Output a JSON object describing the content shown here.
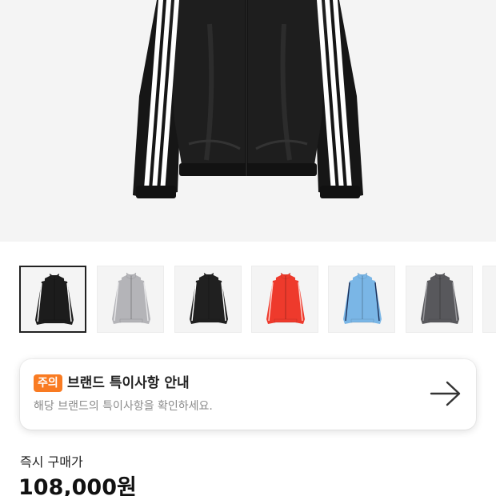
{
  "product": {
    "hero_image": "black track jacket with three white stripes, main photo",
    "thumbnails": [
      {
        "name": "black",
        "body": "#1c1c1c",
        "stripe": "#ffffff",
        "bg": "#f4f4f4",
        "selected": true
      },
      {
        "name": "light-gray",
        "body": "#b4b4b8",
        "stripe": "#e6e6e8",
        "bg": "#f4f4f4",
        "selected": false
      },
      {
        "name": "black-2",
        "body": "#202020",
        "stripe": "#ffffff",
        "bg": "#f4f4f4",
        "selected": false
      },
      {
        "name": "red",
        "body": "#ee3a2c",
        "stripe": "#ffd2cc",
        "bg": "#f4f4f4",
        "selected": false
      },
      {
        "name": "light-blue",
        "body": "#7ab6e6",
        "stripe": "#1c2d55",
        "bg": "#f4f4f4",
        "selected": false
      },
      {
        "name": "dark-gray",
        "body": "#58585c",
        "stripe": "#9a9a9e",
        "bg": "#f4f4f4",
        "selected": false
      },
      {
        "name": "partial",
        "body": "#f4f4f4",
        "stripe": "#f4f4f4",
        "bg": "#f4f4f4",
        "selected": false
      }
    ]
  },
  "notice": {
    "badge": "주의",
    "title": "브랜드 특이사항 안내",
    "subtitle": "해당 브랜드의 특이사항을 확인하세요.",
    "arrow_icon": "arrow-right-icon"
  },
  "price": {
    "label": "즉시 구매가",
    "value": "108,000원"
  },
  "colors": {
    "accent": "#f97b22",
    "hero_bg": "#f4f4f4"
  }
}
